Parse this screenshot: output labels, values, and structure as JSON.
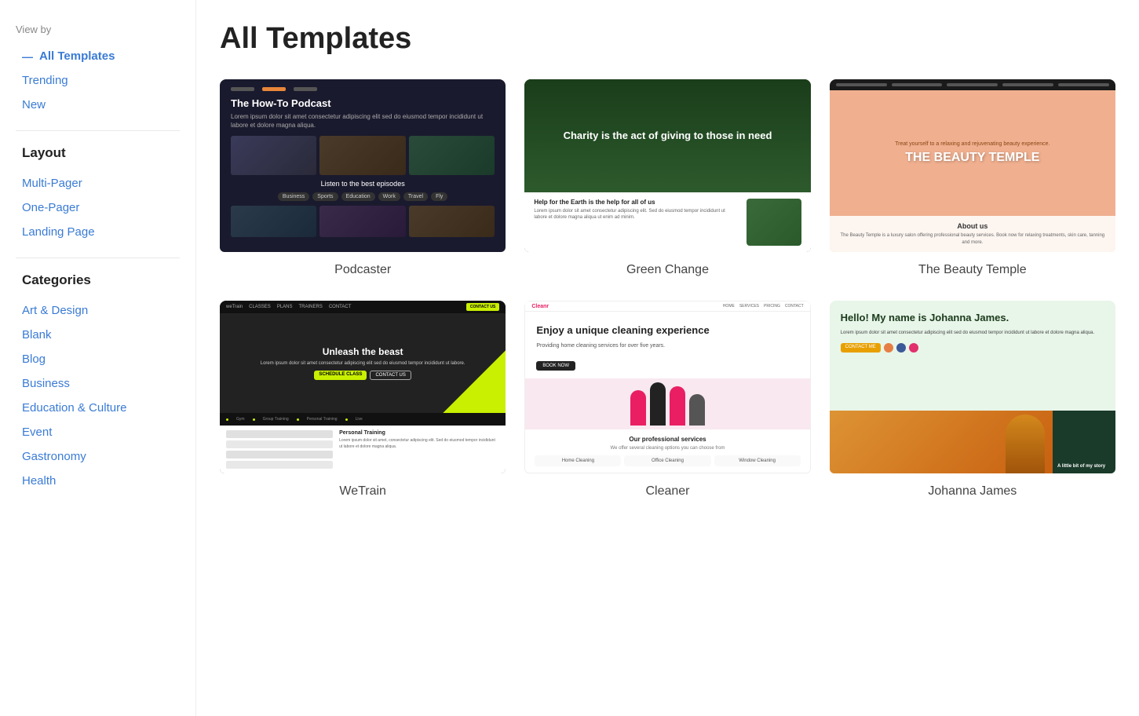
{
  "sidebar": {
    "view_by_label": "View by",
    "nav_items": [
      {
        "id": "all-templates",
        "label": "All Templates",
        "active": true
      },
      {
        "id": "trending",
        "label": "Trending",
        "active": false
      },
      {
        "id": "new",
        "label": "New",
        "active": false
      }
    ],
    "layout_title": "Layout",
    "layout_items": [
      {
        "id": "multi-pager",
        "label": "Multi-Pager"
      },
      {
        "id": "one-pager",
        "label": "One-Pager"
      },
      {
        "id": "landing-page",
        "label": "Landing Page"
      }
    ],
    "categories_title": "Categories",
    "category_items": [
      {
        "id": "art-design",
        "label": "Art & Design"
      },
      {
        "id": "blank",
        "label": "Blank"
      },
      {
        "id": "blog",
        "label": "Blog"
      },
      {
        "id": "business",
        "label": "Business"
      },
      {
        "id": "education-culture",
        "label": "Education & Culture"
      },
      {
        "id": "event",
        "label": "Event"
      },
      {
        "id": "gastronomy",
        "label": "Gastronomy"
      },
      {
        "id": "health",
        "label": "Health"
      }
    ]
  },
  "main": {
    "page_title": "All Templates",
    "templates": [
      {
        "id": "podcaster",
        "name": "Podcaster",
        "thumb_type": "podcaster",
        "hero_text": "The How-To Podcast",
        "sub_text": "Listen to the best episodes"
      },
      {
        "id": "green-change",
        "name": "Green Change",
        "thumb_type": "green",
        "hero_text": "Charity is the act of giving to those in need",
        "bottom_text": "Help for the Earth is the help for all of us"
      },
      {
        "id": "beauty-temple",
        "name": "The Beauty Temple",
        "thumb_type": "beauty",
        "tagline": "Treat yourself to a relaxing and rejuvenating beauty experience.",
        "main_title": "THE BEAUTY TEMPLE",
        "about_title": "About us"
      },
      {
        "id": "wetrain",
        "name": "WeTrain",
        "thumb_type": "wetrain",
        "hero_text": "Unleash the beast",
        "ticker_items": [
          "Gym",
          "Group Training",
          "Personal Training",
          "Live"
        ]
      },
      {
        "id": "cleaner",
        "name": "Cleaner",
        "thumb_type": "cleaner",
        "hero_title": "Enjoy a unique cleaning experience",
        "hero_sub": "Providing home cleaning services for over five years.",
        "services_title": "Our professional services",
        "services_sub": "We offer several cleaning options you can choose from",
        "service_items": [
          "Home Cleaning",
          "Office Cleaning",
          "Window Cleaning"
        ]
      },
      {
        "id": "johanna-james",
        "name": "Johanna James",
        "thumb_type": "johanna",
        "name_text": "Hello! My name is Johanna James.",
        "story_text": "A little bit of my story"
      }
    ]
  }
}
